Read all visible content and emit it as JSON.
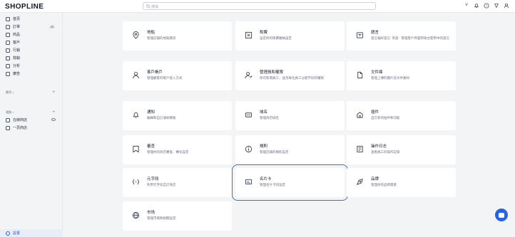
{
  "header": {
    "logo": "SHOPLINE",
    "search_placeholder": "搜尋",
    "icons": [
      "chevron-down-icon",
      "bell-icon",
      "help-icon",
      "flag-icon",
      "avatar"
    ]
  },
  "sidebar": {
    "items": [
      {
        "label": "首頁",
        "icon": "home-icon"
      },
      {
        "label": "訂單",
        "icon": "orders-icon",
        "badge": "28"
      },
      {
        "label": "商品",
        "icon": "products-icon"
      },
      {
        "label": "客戶",
        "icon": "customers-icon"
      },
      {
        "label": "行銷",
        "icon": "marketing-icon"
      },
      {
        "label": "營銷",
        "icon": "promotions-icon"
      },
      {
        "label": "分析",
        "icon": "analytics-icon"
      },
      {
        "label": "廣告",
        "icon": "ads-icon"
      }
    ],
    "section_apps": "應用 >",
    "section_channels": "通路 >",
    "channels": [
      {
        "label": "在線商店",
        "icon": "store-icon"
      },
      {
        "label": "一頁商店",
        "icon": "page-icon"
      }
    ],
    "settings_label": "設置"
  },
  "cards": [
    {
      "title": "地點",
      "desc": "管理店鋪的地點資訊",
      "icon": "location-icon"
    },
    {
      "title": "稅費",
      "desc": "設定你的稅費繳納設定",
      "icon": "tax-icon"
    },
    {
      "title": "語言",
      "desc": "語言偏好語言: 英語 · 管理客戶界面和後台使用中的語言",
      "icon": "language-icon"
    },
    {
      "title": "客戶帳戶",
      "desc": "管理顧客的帳戶登入方式",
      "icon": "customer-account-icon"
    },
    {
      "title": "管理員和權限",
      "desc": "你可新增員工，並為每位員工分配不同的權限",
      "icon": "staff-permission-icon"
    },
    {
      "title": "文件庫",
      "desc": "管理上傳的圖片及文件素材",
      "icon": "files-icon"
    },
    {
      "title": "通知",
      "desc": "編輯和自訂通知模板",
      "icon": "notification-icon"
    },
    {
      "title": "域名",
      "desc": "管理商店域名",
      "icon": "domain-icon"
    },
    {
      "title": "插件",
      "desc": "自訂新的插件和功能",
      "icon": "plugin-icon"
    },
    {
      "title": "審查",
      "desc": "管理你的商店審查、轉化設定",
      "icon": "review-icon"
    },
    {
      "title": "規則",
      "desc": "管理店鋪的規則設定",
      "icon": "rules-icon"
    },
    {
      "title": "操作日志",
      "desc": "查看員工的操作記錄",
      "icon": "log-icon"
    },
    {
      "title": "元字段",
      "desc": "利用元字段自訂商店",
      "icon": "metafield-icon"
    },
    {
      "title": "名片卡",
      "desc": "管理名片卡的設定",
      "icon": "card-icon"
    },
    {
      "title": "品牌",
      "desc": "管理你的品牌資產",
      "icon": "brand-icon"
    },
    {
      "title": "市场",
      "desc": "管理市場和相關設定",
      "icon": "market-icon"
    }
  ],
  "colors": {
    "accent": "#2563eb",
    "selected_outline": "#3b6fd8",
    "background": "#f3f4f6"
  }
}
